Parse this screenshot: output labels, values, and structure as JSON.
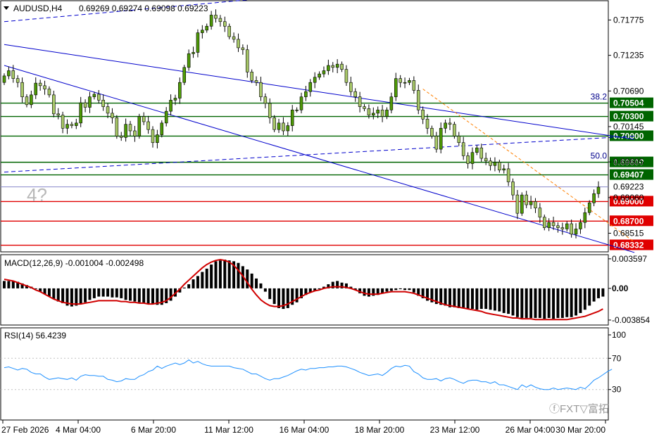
{
  "header": {
    "symbol": "AUDUSD,H4",
    "ohlc": "0.69269 0.69274 0.69098 0.69223"
  },
  "watermark": "4?",
  "logo": "FXTrading.com 富拓",
  "colors": {
    "bull": "#4e9a06",
    "bear": "#a8c868",
    "wick": "#000000",
    "channel": "#0000cc",
    "fibo": "#ff8000",
    "green_level": "#006400",
    "red_level": "#e00000",
    "macd_line": "#d00000",
    "rsi_line": "#1e90ff"
  },
  "chart_data": [
    {
      "type": "candlestick",
      "title": "AUDUSD,H4",
      "ylim": [
        0.6823,
        0.7207
      ],
      "y_ticks": [
        "0.71775",
        "0.71235",
        "0.70690",
        "0.70145",
        "0.69605",
        "0.69060",
        "0.68515"
      ],
      "x_ticks": [
        "27 Feb 2026",
        "4 Mar 04:00",
        "6 Mar 20:00",
        "11 Mar 12:00",
        "16 Mar 04:00",
        "18 Mar 20:00",
        "23 Mar 12:00",
        "26 Mar 04:00",
        "30 Mar 20:00"
      ],
      "close": [
        0.7092,
        0.71,
        0.7088,
        0.7082,
        0.706,
        0.7048,
        0.7063,
        0.7081,
        0.7077,
        0.7072,
        0.7063,
        0.7034,
        0.7032,
        0.7012,
        0.7018,
        0.7016,
        0.702,
        0.7051,
        0.7044,
        0.706,
        0.7064,
        0.7055,
        0.7045,
        0.7035,
        0.7028,
        0.7,
        0.6998,
        0.7018,
        0.7008,
        0.7,
        0.703,
        0.7022,
        0.701,
        0.699,
        0.7002,
        0.702,
        0.7038,
        0.7055,
        0.7058,
        0.7082,
        0.7105,
        0.7126,
        0.7128,
        0.7158,
        0.7162,
        0.7168,
        0.7185,
        0.718,
        0.7175,
        0.7168,
        0.7152,
        0.7148,
        0.7135,
        0.7132,
        0.7098,
        0.7085,
        0.7082,
        0.706,
        0.705,
        0.7028,
        0.701,
        0.702,
        0.7008,
        0.7016,
        0.704,
        0.704,
        0.706,
        0.7068,
        0.7082,
        0.709,
        0.7095,
        0.71,
        0.7108,
        0.7105,
        0.711,
        0.7102,
        0.7082,
        0.7068,
        0.706,
        0.7045,
        0.7042,
        0.7032,
        0.7035,
        0.704,
        0.703,
        0.704,
        0.706,
        0.7088,
        0.7082,
        0.7082,
        0.7085,
        0.707,
        0.704,
        0.7026,
        0.7012,
        0.7,
        0.698,
        0.7012,
        0.702,
        0.7018,
        0.7,
        0.699,
        0.697,
        0.6958,
        0.6975,
        0.6982,
        0.6966,
        0.6962,
        0.6955,
        0.696,
        0.6948,
        0.695,
        0.693,
        0.691,
        0.6882,
        0.691,
        0.6895,
        0.69,
        0.689,
        0.6876,
        0.686,
        0.6868,
        0.6863,
        0.686,
        0.6858,
        0.6866,
        0.685,
        0.6858,
        0.6868,
        0.6883,
        0.6898,
        0.6912,
        0.6922
      ],
      "levels": [
        {
          "label": "0.70504",
          "value": 0.70504,
          "kind": "green"
        },
        {
          "label": "0.70300",
          "value": 0.703,
          "kind": "green"
        },
        {
          "label": "0.70000",
          "value": 0.7,
          "kind": "green"
        },
        {
          "label": "0.69600",
          "value": 0.696,
          "kind": "green"
        },
        {
          "label": "0.69407",
          "value": 0.69407,
          "kind": "green"
        },
        {
          "label": "0.69223",
          "value": 0.69223,
          "kind": "current"
        },
        {
          "label": "0.69000",
          "value": 0.69,
          "kind": "red"
        },
        {
          "label": "0.68700",
          "value": 0.687,
          "kind": "red"
        },
        {
          "label": "0.68332",
          "value": 0.68332,
          "kind": "red"
        }
      ],
      "fibo_labels": [
        {
          "label": "38.2",
          "value": 0.70504
        },
        {
          "label": "50.0",
          "value": 0.696
        }
      ]
    },
    {
      "type": "histogram",
      "title": "MACD(12,26,9) -0.001004 -0.002498",
      "y_ticks": [
        "0.003597",
        "0.00",
        "-0.003854"
      ],
      "ylim": [
        -0.00446,
        0.0041
      ],
      "macd": [
        0.0009,
        0.0009,
        0.0009,
        0.0008,
        0.0006,
        0.0004,
        0.0002,
        0.0,
        -0.0004,
        -0.0007,
        -0.001,
        -0.0013,
        -0.0016,
        -0.0018,
        -0.0021,
        -0.0022,
        -0.0021,
        -0.0019,
        -0.0017,
        -0.0014,
        -0.0012,
        -0.001,
        -0.001,
        -0.001,
        -0.0011,
        -0.0011,
        -0.0012,
        -0.0014,
        -0.0015,
        -0.0016,
        -0.0017,
        -0.0018,
        -0.0019,
        -0.0019,
        -0.002,
        -0.002,
        -0.0018,
        -0.0015,
        -0.001,
        -0.0005,
        0.0001,
        0.0005,
        0.0011,
        0.0015,
        0.002,
        0.0024,
        0.0029,
        0.0033,
        0.0034,
        0.0035,
        0.0034,
        0.0033,
        0.0031,
        0.0027,
        0.0023,
        0.0018,
        0.0012,
        0.0006,
        -0.0004,
        -0.0013,
        -0.0019,
        -0.0024,
        -0.0025,
        -0.0024,
        -0.002,
        -0.0017,
        -0.0012,
        -0.0008,
        -0.0005,
        -0.0003,
        -0.0001,
        0.0002,
        0.0005,
        0.0008,
        0.0009,
        0.0007,
        0.0006,
        0.0002,
        -0.0002,
        -0.0006,
        -0.0009,
        -0.001,
        -0.0009,
        -0.0008,
        -0.0006,
        -0.0004,
        -0.0003,
        -0.0002,
        -0.0001,
        -0.0002,
        -0.0002,
        -0.0005,
        -0.0009,
        -0.0012,
        -0.0015,
        -0.0017,
        -0.0019,
        -0.002,
        -0.0021,
        -0.0023,
        -0.0023,
        -0.0024,
        -0.0024,
        -0.0025,
        -0.0025,
        -0.0026,
        -0.0025,
        -0.0025,
        -0.0026,
        -0.0027,
        -0.0028,
        -0.003,
        -0.0031,
        -0.0033,
        -0.0035,
        -0.0036,
        -0.0036,
        -0.0036,
        -0.0036,
        -0.0036,
        -0.0037,
        -0.0036,
        -0.0037,
        -0.0036,
        -0.0036,
        -0.0035,
        -0.0035,
        -0.0033,
        -0.003,
        -0.0026,
        -0.0021,
        -0.0016,
        -0.0012,
        -0.001
      ],
      "signal": [
        0.0011,
        0.001,
        0.0009,
        0.0007,
        0.0005,
        0.0003,
        0.0001,
        -0.0002,
        -0.0004,
        -0.0007,
        -0.001,
        -0.0013,
        -0.0015,
        -0.0017,
        -0.0018,
        -0.0019,
        -0.0019,
        -0.0019,
        -0.0018,
        -0.0017,
        -0.0016,
        -0.0015,
        -0.0015,
        -0.0015,
        -0.0015,
        -0.0015,
        -0.0016,
        -0.0016,
        -0.0017,
        -0.0017,
        -0.0018,
        -0.0018,
        -0.0019,
        -0.0019,
        -0.0018,
        -0.0017,
        -0.0015,
        -0.0011,
        -0.0006,
        -0.0001,
        0.0005,
        0.001,
        0.0015,
        0.002,
        0.0025,
        0.0029,
        0.0032,
        0.0034,
        0.0035,
        0.0034,
        0.0032,
        0.0028,
        0.0022,
        0.0015,
        0.0007,
        -0.0001,
        -0.0008,
        -0.0014,
        -0.0018,
        -0.0021,
        -0.0022,
        -0.0022,
        -0.0021,
        -0.0019,
        -0.0016,
        -0.0013,
        -0.001,
        -0.0007,
        -0.0005,
        -0.0003,
        -0.0002,
        0.0,
        0.0001,
        0.0002,
        0.0002,
        0.0002,
        0.0001,
        0.0,
        -0.0002,
        -0.0004,
        -0.0006,
        -0.0007,
        -0.0007,
        -0.0007,
        -0.0006,
        -0.0005,
        -0.0004,
        -0.0004,
        -0.0004,
        -0.0004,
        -0.0005,
        -0.0006,
        -0.0008,
        -0.001,
        -0.0012,
        -0.0014,
        -0.0016,
        -0.0018,
        -0.002,
        -0.0021,
        -0.0022,
        -0.0023,
        -0.0024,
        -0.0025,
        -0.0026,
        -0.0027,
        -0.0028,
        -0.003,
        -0.0031,
        -0.0032,
        -0.0033,
        -0.0034,
        -0.0035,
        -0.0036,
        -0.0036,
        -0.0037,
        -0.0037,
        -0.0037,
        -0.0038,
        -0.0038,
        -0.0038,
        -0.0038,
        -0.0038,
        -0.0038,
        -0.0038,
        -0.0038,
        -0.0037,
        -0.0036,
        -0.0035,
        -0.0034,
        -0.0032,
        -0.003,
        -0.0028,
        -0.0025
      ]
    },
    {
      "type": "line",
      "title": "RSI(14) 56.4239",
      "y_ticks": [
        "100",
        "70",
        "30"
      ],
      "ylim": [
        0,
        100
      ],
      "values": [
        58,
        59,
        57,
        55,
        57,
        56,
        52,
        50,
        50,
        46,
        43,
        44,
        45,
        44,
        43,
        45,
        42,
        47,
        49,
        48,
        48,
        47,
        47,
        43,
        42,
        40,
        41,
        44,
        43,
        43,
        47,
        49,
        53,
        55,
        60,
        57,
        60,
        62,
        64,
        62,
        64,
        68,
        64,
        66,
        63,
        61,
        60,
        60,
        60,
        60,
        60,
        58,
        57,
        56,
        53,
        50,
        50,
        47,
        44,
        42,
        44,
        44,
        46,
        48,
        51,
        54,
        56,
        55,
        57,
        57,
        58,
        58,
        59,
        59,
        60,
        60,
        59,
        57,
        55,
        52,
        50,
        48,
        49,
        50,
        48,
        52,
        57,
        60,
        59,
        61,
        60,
        53,
        50,
        45,
        43,
        43,
        44,
        41,
        44,
        45,
        43,
        40,
        38,
        41,
        42,
        42,
        40,
        40,
        38,
        40,
        36,
        36,
        34,
        32,
        30,
        36,
        33,
        36,
        33,
        31,
        30,
        30,
        32,
        30,
        31,
        32,
        31,
        30,
        33,
        31,
        36,
        42,
        45,
        49,
        53,
        56
      ]
    }
  ]
}
